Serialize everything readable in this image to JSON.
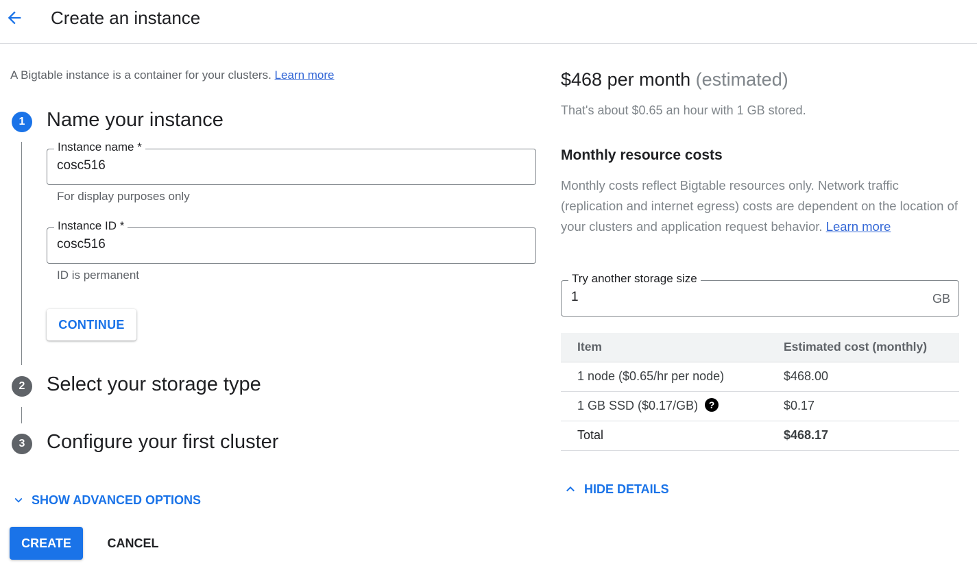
{
  "header": {
    "back_icon": "arrow-back-icon",
    "title": "Create an instance"
  },
  "intro": {
    "text": "A Bigtable instance is a container for your clusters.",
    "link": "Learn more"
  },
  "steps": [
    {
      "number": "1",
      "title": "Name your instance",
      "state": "active"
    },
    {
      "number": "2",
      "title": "Select your storage type",
      "state": "inactive"
    },
    {
      "number": "3",
      "title": "Configure your first cluster",
      "state": "inactive"
    }
  ],
  "form": {
    "instance_name": {
      "label": "Instance name *",
      "value": "cosc516",
      "helper": "For display purposes only"
    },
    "instance_id": {
      "label": "Instance ID *",
      "value": "cosc516",
      "helper": "ID is permanent"
    },
    "continue_label": "CONTINUE"
  },
  "advanced": {
    "label": "SHOW ADVANCED OPTIONS",
    "icon": "chevron-down-icon"
  },
  "actions": {
    "create_label": "CREATE",
    "cancel_label": "CANCEL"
  },
  "pricing": {
    "price": "$468 per month",
    "estimated": "(estimated)",
    "subtitle": "That's about $0.65 an hour with 1 GB stored.",
    "costs_heading": "Monthly resource costs",
    "costs_description": "Monthly costs reflect Bigtable resources only. Network traffic (replication and internet egress) costs are dependent on the location of your clusters and application request behavior.",
    "costs_link": "Learn more",
    "storage": {
      "label": "Try another storage size",
      "value": "1",
      "unit": "GB"
    },
    "table": {
      "headers": [
        "Item",
        "Estimated cost (monthly)"
      ],
      "rows": [
        {
          "item": "1 node ($0.65/hr per node)",
          "cost": "$468.00"
        },
        {
          "item": "1 GB SSD ($0.17/GB)",
          "cost": "$0.17",
          "help_icon": "?"
        }
      ],
      "total": {
        "label": "Total",
        "cost": "$468.17"
      }
    },
    "hide_details": {
      "label": "HIDE DETAILS",
      "icon": "chevron-up-icon"
    }
  },
  "colors": {
    "accent": "#1a73e8",
    "muted": "#5f6368",
    "step_inactive": "#5f6368"
  }
}
